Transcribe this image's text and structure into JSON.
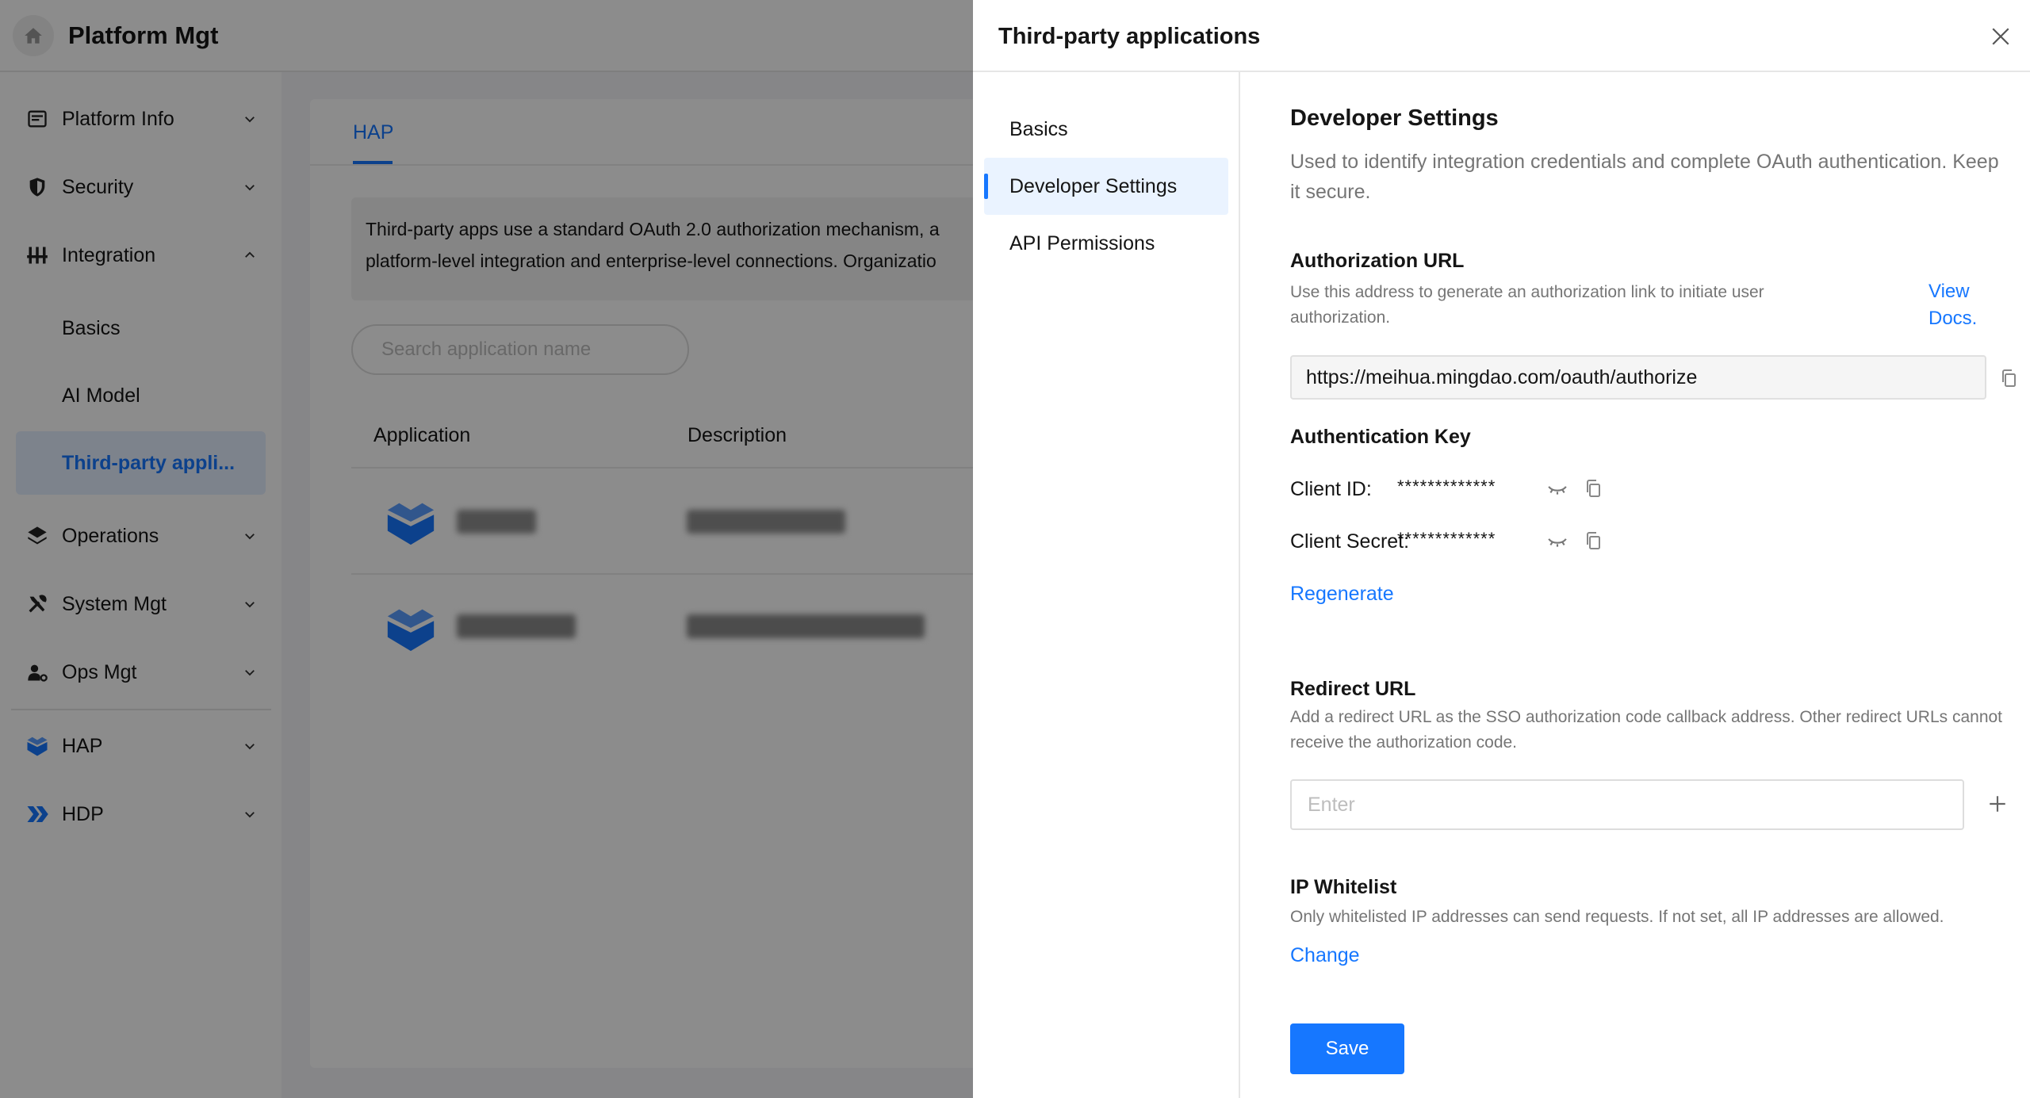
{
  "header": {
    "title": "Platform Mgt"
  },
  "sidebar": {
    "items": [
      {
        "label": "Platform Info",
        "icon": "info-card-icon"
      },
      {
        "label": "Security",
        "icon": "shield-icon"
      },
      {
        "label": "Integration",
        "icon": "sliders-icon"
      },
      {
        "label": "Operations",
        "icon": "layers-icon"
      },
      {
        "label": "System Mgt",
        "icon": "tools-icon"
      },
      {
        "label": "Ops Mgt",
        "icon": "user-gear-icon"
      },
      {
        "label": "HAP",
        "icon": "hap-logo-icon"
      },
      {
        "label": "HDP",
        "icon": "hdp-logo-icon"
      }
    ],
    "integration_sub": [
      {
        "label": "Basics"
      },
      {
        "label": "AI Model"
      },
      {
        "label": "Third-party appli..."
      }
    ]
  },
  "main": {
    "tab": "HAP",
    "notice_line1": "Third-party apps use a standard OAuth 2.0 authorization mechanism, a",
    "notice_line2": "platform-level integration and enterprise-level connections. Organizatio",
    "search_placeholder": "Search application name",
    "columns": [
      "Application",
      "Description"
    ]
  },
  "drawer": {
    "title": "Third-party applications",
    "nav": [
      {
        "label": "Basics"
      },
      {
        "label": "Developer Settings"
      },
      {
        "label": "API Permissions"
      }
    ],
    "developer_settings": {
      "title": "Developer Settings",
      "description": "Used to identify integration credentials and complete OAuth authentication. Keep it secure.",
      "auth_url": {
        "title": "Authorization URL",
        "description": "Use this address to generate an authorization link to initiate user authorization.",
        "docs_link": "View Docs.",
        "value": "https://meihua.mingdao.com/oauth/authorize"
      },
      "auth_key": {
        "title": "Authentication Key",
        "client_id_label": "Client ID:",
        "client_id_value": "*************",
        "client_secret_label": "Client Secret:",
        "client_secret_value": "*************",
        "regenerate": "Regenerate"
      },
      "redirect_url": {
        "title": "Redirect URL",
        "description": "Add a redirect URL as the SSO authorization code callback address. Other redirect URLs cannot receive the authorization code.",
        "placeholder": "Enter"
      },
      "ip_whitelist": {
        "title": "IP Whitelist",
        "description": "Only whitelisted IP addresses can send requests. If not set, all IP addresses are allowed.",
        "change": "Change"
      },
      "save": "Save"
    }
  },
  "colors": {
    "accent": "#1677ff",
    "overlay": "rgba(0,0,0,0.45)"
  }
}
